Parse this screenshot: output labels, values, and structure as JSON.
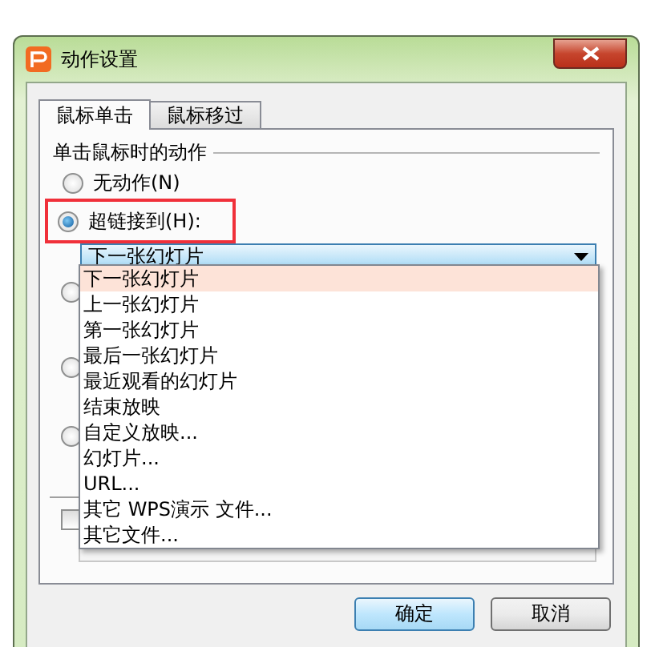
{
  "window": {
    "title": "动作设置"
  },
  "tabs": [
    {
      "label": "鼠标单击",
      "selected": true
    },
    {
      "label": "鼠标移过",
      "selected": false
    }
  ],
  "group": {
    "title": "单击鼠标时的动作"
  },
  "options": [
    {
      "label": "无动作(N)",
      "selected": false,
      "highlighted": false
    },
    {
      "label": "超链接到(H):",
      "selected": true,
      "highlighted": true
    }
  ],
  "hyperlink_select": {
    "value": "下一张幻灯片",
    "open": true
  },
  "dropdown_items": [
    {
      "label": "下一张幻灯片",
      "selected": true
    },
    {
      "label": "上一张幻灯片",
      "selected": false
    },
    {
      "label": "第一张幻灯片",
      "selected": false
    },
    {
      "label": "最后一张幻灯片",
      "selected": false
    },
    {
      "label": "最近观看的幻灯片",
      "selected": false
    },
    {
      "label": "结束放映",
      "selected": false
    },
    {
      "label": "自定义放映...",
      "selected": false
    },
    {
      "label": "幻灯片...",
      "selected": false
    },
    {
      "label": "URL...",
      "selected": false
    },
    {
      "label": "其它 WPS演示 文件...",
      "selected": false
    },
    {
      "label": "其它文件...",
      "selected": false
    }
  ],
  "covered_options": [
    {
      "selected": false
    },
    {
      "selected": false
    },
    {
      "selected": false
    }
  ],
  "sound": {
    "checked": false
  },
  "buttons": [
    {
      "label": "确定",
      "default": true
    },
    {
      "label": "取消",
      "default": false
    }
  ]
}
